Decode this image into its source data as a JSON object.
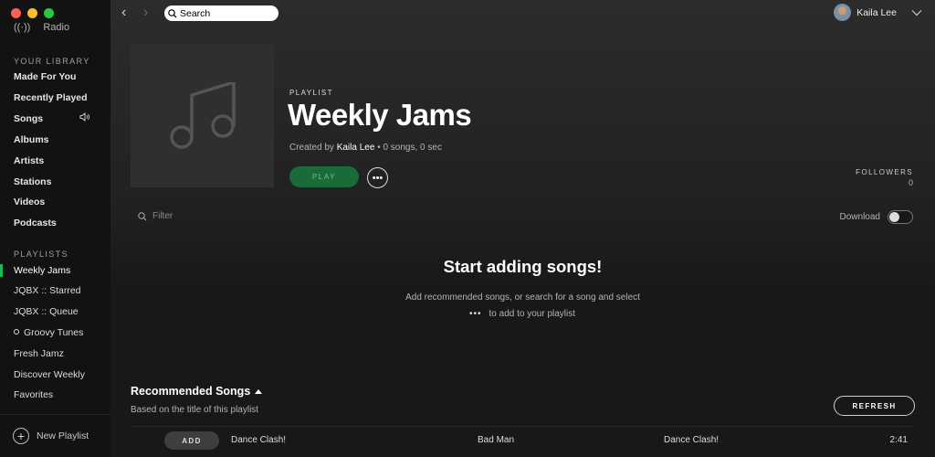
{
  "sidebar": {
    "top_item": "Radio",
    "library_label": "YOUR LIBRARY",
    "library_items": [
      "Made For You",
      "Recently Played",
      "Songs",
      "Albums",
      "Artists",
      "Stations",
      "Videos",
      "Podcasts"
    ],
    "playlists_label": "PLAYLISTS",
    "playlists": [
      "Weekly Jams",
      "JQBX :: Starred",
      "JQBX :: Queue",
      "Groovy Tunes",
      "Fresh Jamz",
      "Discover Weekly",
      "Favorites"
    ],
    "new_playlist": "New Playlist"
  },
  "topbar": {
    "search_placeholder": "Search",
    "user_name": "Kaila Lee"
  },
  "playlist": {
    "type": "PLAYLIST",
    "title": "Weekly Jams",
    "created_by_prefix": "Created by",
    "owner": "Kaila Lee",
    "stats": "• 0 songs, 0 sec",
    "play_label": "PLAY",
    "more_label": "•••",
    "followers_label": "FOLLOWERS",
    "followers_count": "0"
  },
  "filter": {
    "placeholder": "Filter"
  },
  "download": {
    "label": "Download",
    "enabled": false
  },
  "empty_state": {
    "title": "Start adding songs!",
    "line1": "Add recommended songs, or search for a song and select",
    "dots": "•••",
    "line2": "to add to your playlist"
  },
  "recommended": {
    "title": "Recommended Songs",
    "subtitle": "Based on the title of this playlist",
    "refresh_label": "REFRESH",
    "songs": [
      {
        "add_label": "ADD",
        "title": "Dance Clash!",
        "artist": "Bad Man",
        "album": "Dance Clash!",
        "duration": "2:41"
      }
    ]
  },
  "colors": {
    "accent": "#1db954",
    "background": "#181818",
    "sidebar": "#121212"
  }
}
